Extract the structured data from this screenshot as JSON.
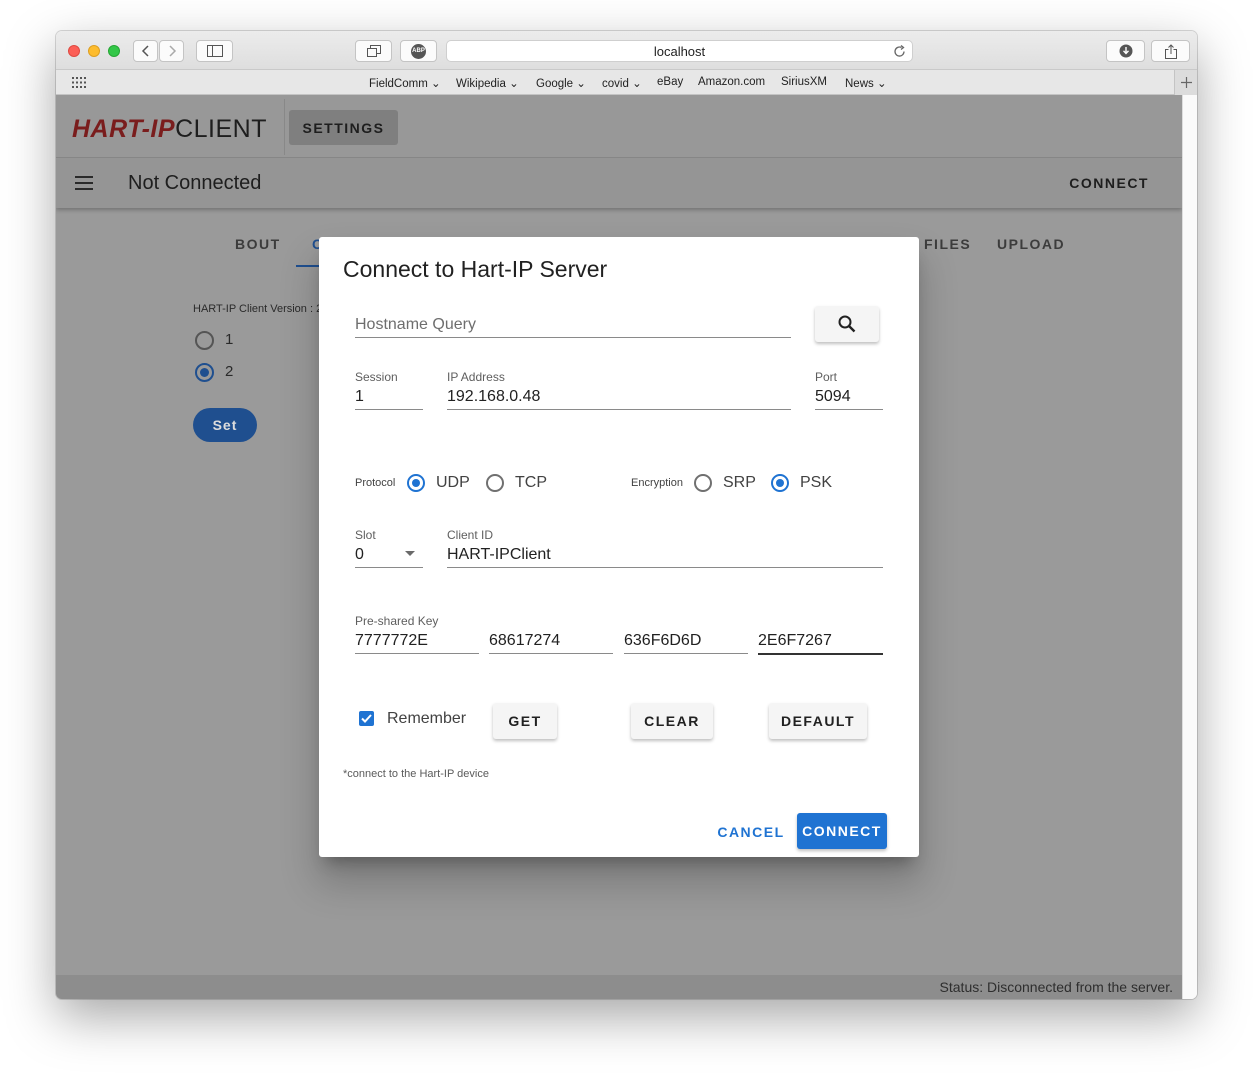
{
  "browser": {
    "url": "localhost",
    "bookmarks": [
      "FieldComm",
      "Wikipedia",
      "Google",
      "covid",
      "eBay",
      "Amazon.com",
      "SiriusXM",
      "News"
    ],
    "abp_label": "ABP"
  },
  "app": {
    "logo_hart": "HART-IP",
    "logo_client": "CLIENT",
    "settings_label": "SETTINGS",
    "connection_status": "Not Connected",
    "toolbar_connect": "CONNECT",
    "tabs": [
      "BOUT",
      "C",
      "FILES",
      "UPLOAD"
    ],
    "version_label": "HART-IP Client Version : 2",
    "version_options": [
      "1",
      "2"
    ],
    "version_selected": "2",
    "set_label": "Set",
    "status_text": "Status: Disconnected from the server."
  },
  "dialog": {
    "title": "Connect to Hart-IP Server",
    "hostname_placeholder": "Hostname Query",
    "session_label": "Session",
    "session_value": "1",
    "ip_label": "IP Address",
    "ip_value": "192.168.0.48",
    "port_label": "Port",
    "port_value": "5094",
    "protocol_label": "Protocol",
    "protocol_options": [
      "UDP",
      "TCP"
    ],
    "protocol_selected": "UDP",
    "encryption_label": "Encryption",
    "encryption_options": [
      "SRP",
      "PSK"
    ],
    "encryption_selected": "PSK",
    "slot_label": "Slot",
    "slot_value": "0",
    "client_id_label": "Client ID",
    "client_id_value": "HART-IPClient",
    "psk_label": "Pre-shared Key",
    "psk_values": [
      "7777772E",
      "68617274",
      "636F6D6D",
      "2E6F7267"
    ],
    "remember_label": "Remember",
    "remember_checked": true,
    "get_label": "GET",
    "clear_label": "CLEAR",
    "default_label": "DEFAULT",
    "note": "*connect to the Hart-IP device",
    "cancel_label": "CANCEL",
    "connect_label": "CONNECT"
  },
  "colors": {
    "primary": "#1f73d2",
    "overlay_primary": "#1f4f8f",
    "logo_red": "#7a1d1d"
  }
}
